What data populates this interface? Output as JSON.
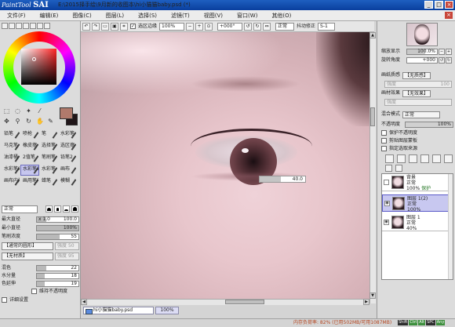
{
  "titlebar": {
    "logo_sub": "PaintTool",
    "logo_main": "SAI",
    "title": "E:\\2015择手绘\\9月新的收图本\\hi小猫猫baby.psd (*)",
    "btn_min": "_",
    "btn_max": "□",
    "btn_close": "×"
  },
  "menu": {
    "items": [
      "文件(F)",
      "编辑(E)",
      "图像(C)",
      "图层(L)",
      "选择(S)",
      "滤镜(T)",
      "视图(V)",
      "窗口(W)",
      "其他(O)"
    ],
    "close": "×"
  },
  "toolbar": {
    "selection_edge_label": "选区边缘",
    "zoom": "100%",
    "rotation": "+000°",
    "mode": "正常",
    "stabilizer_label": "抖动修正",
    "stabilizer": "S-1"
  },
  "colors": {
    "primary": "#b07a6c",
    "secondary": "#1f1518",
    "accent": "#c8463a",
    "selection": "#c6c6ee"
  },
  "brushes": [
    {
      "label": "铅笔",
      "selected": false
    },
    {
      "label": "喷枪",
      "selected": false
    },
    {
      "label": "笔",
      "selected": false
    },
    {
      "label": "水彩笔",
      "selected": false
    },
    {
      "label": "马克笔",
      "selected": false
    },
    {
      "label": "橡皮擦",
      "selected": false
    },
    {
      "label": "选择笔",
      "selected": false
    },
    {
      "label": "选区擦",
      "selected": false
    },
    {
      "label": "油漆桶",
      "selected": false
    },
    {
      "label": "2值笔",
      "selected": false
    },
    {
      "label": "笔刷笔",
      "selected": false
    },
    {
      "label": "铅笔2",
      "selected": false
    },
    {
      "label": "水彩笔9画",
      "selected": false
    },
    {
      "label": "水彩笔10画",
      "selected": true
    },
    {
      "label": "水彩笔",
      "selected": false
    },
    {
      "label": "画布",
      "selected": false
    },
    {
      "label": "画布内阁",
      "selected": false
    },
    {
      "label": "画用笔内画",
      "selected": false
    },
    {
      "label": "蜡笔",
      "selected": false
    },
    {
      "label": "模糊",
      "selected": false
    }
  ],
  "brush_params": {
    "mode": "正常",
    "max_size_label": "最大直径",
    "max_size_mult": "x 1.0",
    "max_size": "100.0",
    "min_size_label": "最小直径",
    "min_size": "100%",
    "density_label": "笔刷浓度",
    "density": "55",
    "shape_select": "【通常的圆形】",
    "shape_strength_label": "强度",
    "shape_strength": "50",
    "texture_select": "【无材质】",
    "texture_strength_label": "强度",
    "texture_strength": "95",
    "blend_label": "混色",
    "blend": "22",
    "water_label": "水分量",
    "water": "18",
    "persistence_label": "色延伸",
    "persistence": "19",
    "keep_opacity_label": "维持不透明度",
    "detail_label": "详细设置"
  },
  "canvas": {
    "value_bar": "40.0"
  },
  "document_tab": {
    "name": "hi小猫猫baby.psd",
    "zoom": "100%"
  },
  "status": {
    "text": "内存负荷率: 82% (已用502MB/可用1087MB)",
    "indicators": [
      "Shift",
      "Ctrl",
      "Alt",
      "SPC",
      "Any"
    ]
  },
  "navigator": {
    "zoom_label": "缩放显示",
    "zoom": "100.0%",
    "rotate_label": "旋转角度",
    "rotate": "+000"
  },
  "layer_props": {
    "texture_label": "画纸质感",
    "texture": "【无质感】",
    "strength_label": "强度",
    "strength": "100",
    "effect_label": "画材效果",
    "effect": "【无效果】",
    "effect_strength_label": "强度",
    "blend_label": "混合模式",
    "blend": "正常",
    "opacity_label": "不透明度",
    "opacity": "100%",
    "protect_label": "保护不透明度",
    "clip_label": "剪贴图层蒙板",
    "source_label": "指定选取来源"
  },
  "layers": [
    {
      "name": "背景",
      "mode": "正常",
      "opacity": "100%",
      "extra": "保护",
      "selected": false
    },
    {
      "name": "图层 1(2)",
      "mode": "正常",
      "opacity": "100%",
      "extra": "",
      "selected": true
    },
    {
      "name": "图层 1",
      "mode": "正常",
      "opacity": "40%",
      "extra": "",
      "selected": false
    }
  ]
}
